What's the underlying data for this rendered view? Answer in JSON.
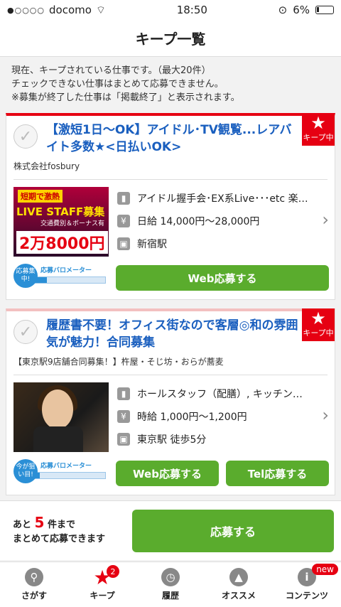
{
  "status": {
    "carrier": "docomo",
    "time": "18:50",
    "battery": "6%"
  },
  "nav": {
    "title": "キープ一覧"
  },
  "intro": {
    "line1": "現在、キープされている仕事です。（最大20件）",
    "line2": "チェックできない仕事はまとめて応募できません。",
    "line3": "※募集が終了した仕事は「掲載終了」と表示されます。"
  },
  "keep_badge": "キープ中",
  "cards": [
    {
      "title": "【激短1日〜OK】アイドル･TV観覧...レアバイト多数★<日払いOK>",
      "company": "株式会社fosbury",
      "thumb": {
        "tag": "短期で激熱",
        "headline": "LIVE STAFF募集",
        "sub": "交通費別＆ボーナス有",
        "pay": "2万8000円"
      },
      "job": "アイドル握手会･EX系Live･･･etc 楽…",
      "wage": "日給 14,000円〜28,000円",
      "station": "新宿駅",
      "meter": {
        "bubble": "応募集中!",
        "label": "応募バロメーター",
        "level": 0.2
      },
      "buttons": {
        "web": "Web応募する"
      }
    },
    {
      "title": "履歴書不要！オフィス街なので客層◎和の雰囲気が魅力！合同募集",
      "company": "【東京駅9店舗合同募集！】杵屋・そじ坊・おらが蕎麦",
      "job": "ホールスタッフ（配膳）, キッチン…",
      "wage": "時給 1,000円〜1,200円",
      "station": "東京駅 徒歩5分",
      "meter": {
        "bubble": "今が狙い目!",
        "label": "応募バロメーター",
        "level": 0.1
      },
      "buttons": {
        "web": "Web応募する",
        "tel": "Tel応募する"
      }
    }
  ],
  "bottom": {
    "prefix": "あと",
    "count": "5",
    "suffix": "件まで",
    "line2": "まとめて応募できます",
    "apply": "応募する"
  },
  "tabs": [
    {
      "label": "さがす",
      "icon": "search-icon"
    },
    {
      "label": "キープ",
      "icon": "star-icon",
      "count": "2"
    },
    {
      "label": "履歴",
      "icon": "clock-icon"
    },
    {
      "label": "オススメ",
      "icon": "thumbs-up-icon"
    },
    {
      "label": "コンテンツ",
      "icon": "info-icon",
      "badge": "new"
    }
  ],
  "colors": {
    "accent": "#e60012",
    "button": "#5aac2d",
    "link": "#1a5fbf"
  }
}
